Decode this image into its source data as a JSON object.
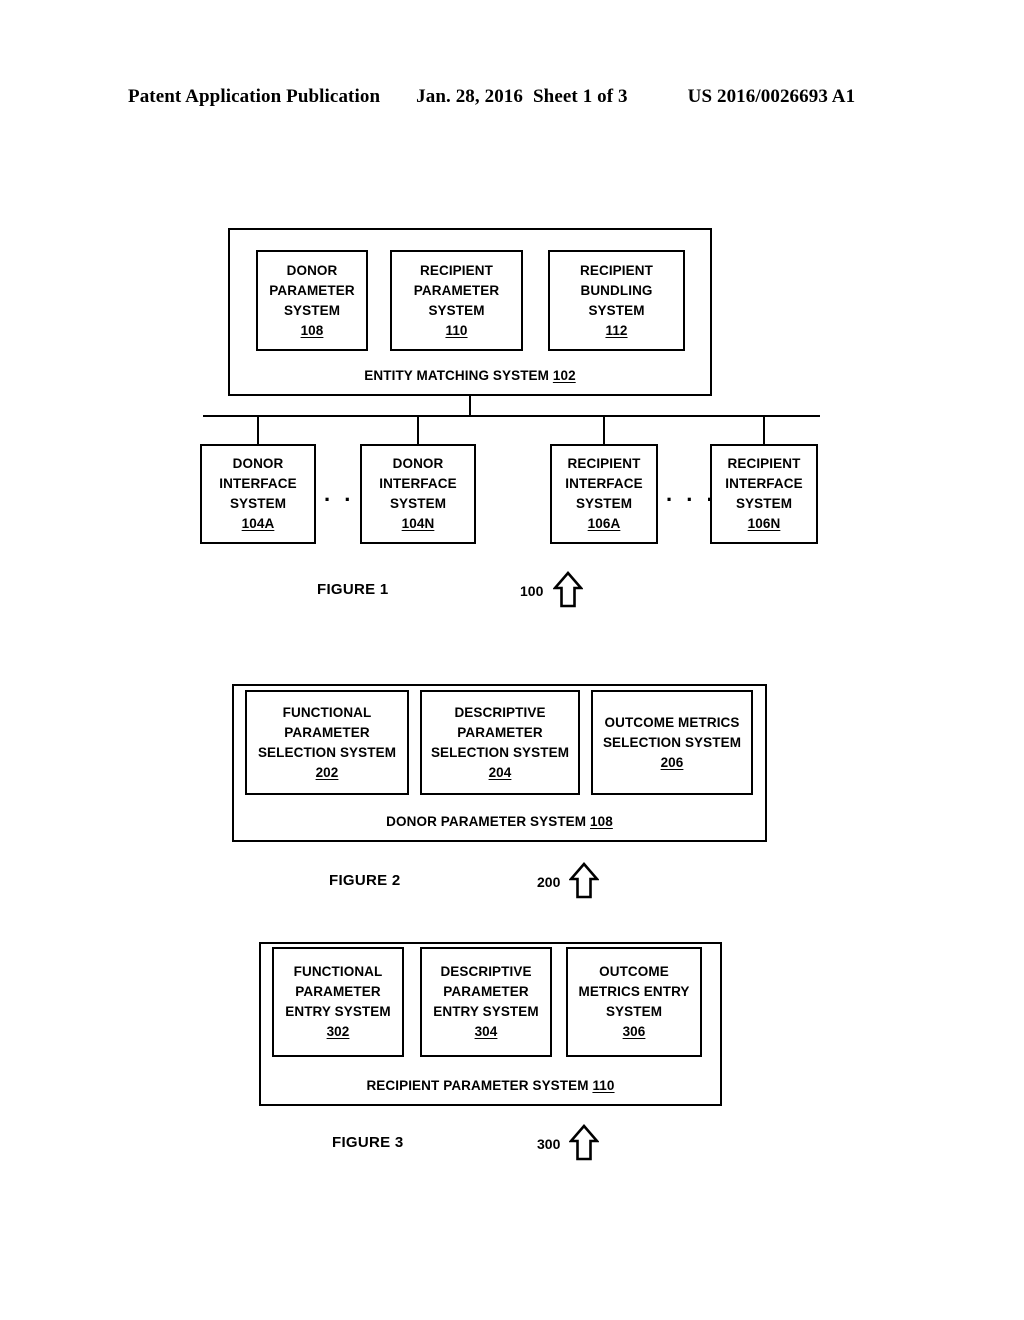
{
  "header": {
    "publication": "Patent Application Publication",
    "date": "Jan. 28, 2016",
    "sheet": "Sheet 1 of 3",
    "patent_number": "US 2016/0026693 A1"
  },
  "figure1": {
    "caption": "FIGURE 1",
    "reference": "100",
    "arrow_icon": "up-arrow-outline-icon",
    "container": {
      "label": "ENTITY MATCHING SYSTEM",
      "ref": "102"
    },
    "modules": [
      {
        "lines": [
          "DONOR",
          "PARAMETER",
          "SYSTEM"
        ],
        "ref": "108"
      },
      {
        "lines": [
          "RECIPIENT",
          "PARAMETER",
          "SYSTEM"
        ],
        "ref": "110"
      },
      {
        "lines": [
          "RECIPIENT",
          "BUNDLING",
          "SYSTEM"
        ],
        "ref": "112"
      }
    ],
    "interfaces": [
      {
        "lines": [
          "DONOR",
          "INTERFACE",
          "SYSTEM"
        ],
        "ref": "104A"
      },
      {
        "lines": [
          "DONOR",
          "INTERFACE",
          "SYSTEM"
        ],
        "ref": "104N"
      },
      {
        "lines": [
          "RECIPIENT",
          "INTERFACE",
          "SYSTEM"
        ],
        "ref": "106A"
      },
      {
        "lines": [
          "RECIPIENT",
          "INTERFACE",
          "SYSTEM"
        ],
        "ref": "106N"
      }
    ],
    "ellipsis": ". . ."
  },
  "figure2": {
    "caption": "FIGURE 2",
    "reference": "200",
    "arrow_icon": "up-arrow-outline-icon",
    "container": {
      "label": "DONOR PARAMETER SYSTEM",
      "ref": "108"
    },
    "modules": [
      {
        "lines": [
          "FUNCTIONAL",
          "PARAMETER",
          "SELECTION SYSTEM"
        ],
        "ref": "202"
      },
      {
        "lines": [
          "DESCRIPTIVE",
          "PARAMETER",
          "SELECTION SYSTEM"
        ],
        "ref": "204"
      },
      {
        "lines": [
          "OUTCOME METRICS",
          "SELECTION SYSTEM"
        ],
        "ref": "206"
      }
    ]
  },
  "figure3": {
    "caption": "FIGURE 3",
    "reference": "300",
    "arrow_icon": "up-arrow-outline-icon",
    "container": {
      "label": "RECIPIENT PARAMETER SYSTEM",
      "ref": "110"
    },
    "modules": [
      {
        "lines": [
          "FUNCTIONAL",
          "PARAMETER",
          "ENTRY SYSTEM"
        ],
        "ref": "302"
      },
      {
        "lines": [
          "DESCRIPTIVE",
          "PARAMETER",
          "ENTRY SYSTEM"
        ],
        "ref": "304"
      },
      {
        "lines": [
          "OUTCOME",
          "METRICS ENTRY",
          "SYSTEM"
        ],
        "ref": "306"
      }
    ]
  }
}
